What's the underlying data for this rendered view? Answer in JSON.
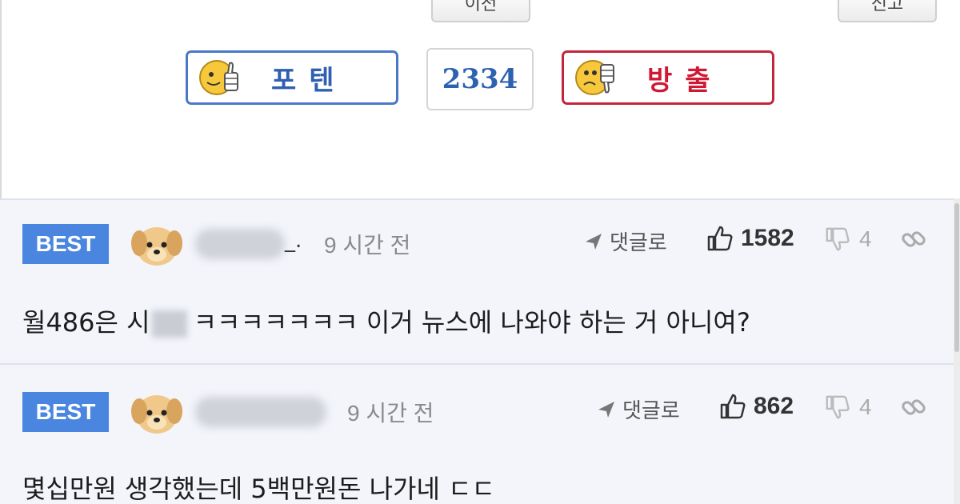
{
  "top_buttons": {
    "left_label": "이전",
    "right_label": "신고"
  },
  "vote": {
    "up_label": "포텐",
    "count": "2334",
    "down_label": "방출"
  },
  "comments": [
    {
      "badge": "BEST",
      "nick_suffix": "_.",
      "time": "9 시간 전",
      "reply_label": "댓글로",
      "likes": "1582",
      "dislikes": "4",
      "text_before": "월486은 시",
      "text_after": "ㅋㅋㅋㅋㅋㅋㅋ 이거 뉴스에 나와야 하는 거 아니여?"
    },
    {
      "badge": "BEST",
      "time": "9 시간 전",
      "reply_label": "댓글로",
      "likes": "862",
      "dislikes": "4",
      "text": "몇십만원 생각했는데 5백만원돈 나가네 ㄷㄷ"
    }
  ],
  "colors": {
    "up": "#2f5fb3",
    "down": "#d01a35",
    "best_badge": "#4a86e0",
    "count": "#2c62b0"
  },
  "icons": [
    "thumbs-up-face-icon",
    "thumbs-down-face-icon",
    "puppy-avatar-icon",
    "reply-arrow-icon",
    "thumbs-up-icon",
    "thumbs-down-icon",
    "link-icon"
  ]
}
